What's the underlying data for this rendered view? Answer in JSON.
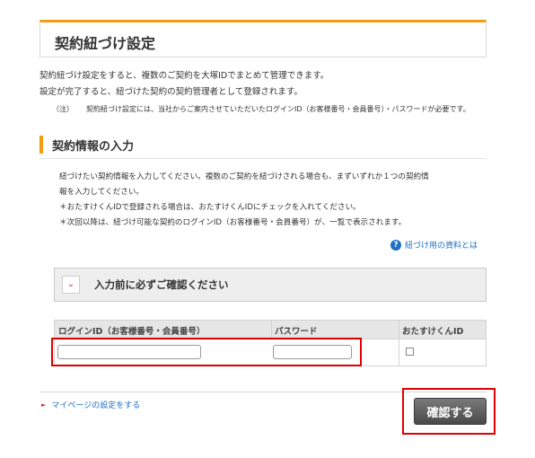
{
  "header": {
    "title": "契約紐づけ設定"
  },
  "intro": {
    "lines": [
      "契約紐づけ設定をすると、複数のご契約を大塚IDでまとめて管理できます。",
      "設定が完了すると、紐づけた契約の契約管理者として登録されます。"
    ],
    "note_label": "（注）",
    "note_text": "契約紐づけ設定には、当社からご案内させていただいたログインID（お客様番号・会員番号）・パスワードが必要です。"
  },
  "section": {
    "title": "契約情報の入力",
    "desc_lines": [
      "紐づけたい契約情報を入力してください。複数のご契約を紐づけされる場合も、まずいずれか１つの契約情",
      "報を入力してください。",
      "＊おたすけくんIDで登録される場合は、おたすけくんIDにチェックを入れてください。",
      "＊次回以降は、紐づけ可能な契約のログインID（お客様番号・会員番号）が、一覧で表示されます。"
    ],
    "doc_link": "紐づけ用の資料とは"
  },
  "notice": {
    "label": "入力前に必ずご確認ください"
  },
  "form": {
    "headers": {
      "login_id": "ログインID（お客様番号・会員番号）",
      "password": "パスワード",
      "otasuke": "おたすけくんID"
    },
    "login_id_value": "",
    "password_value": "",
    "otasuke_checked": false
  },
  "footer": {
    "mypage_link": "マイページの設定をする",
    "confirm_button": "確認する"
  },
  "colors": {
    "accent": "#f39c12",
    "link": "#1f6fc4",
    "highlight": "#e00000",
    "button": "#555555"
  }
}
